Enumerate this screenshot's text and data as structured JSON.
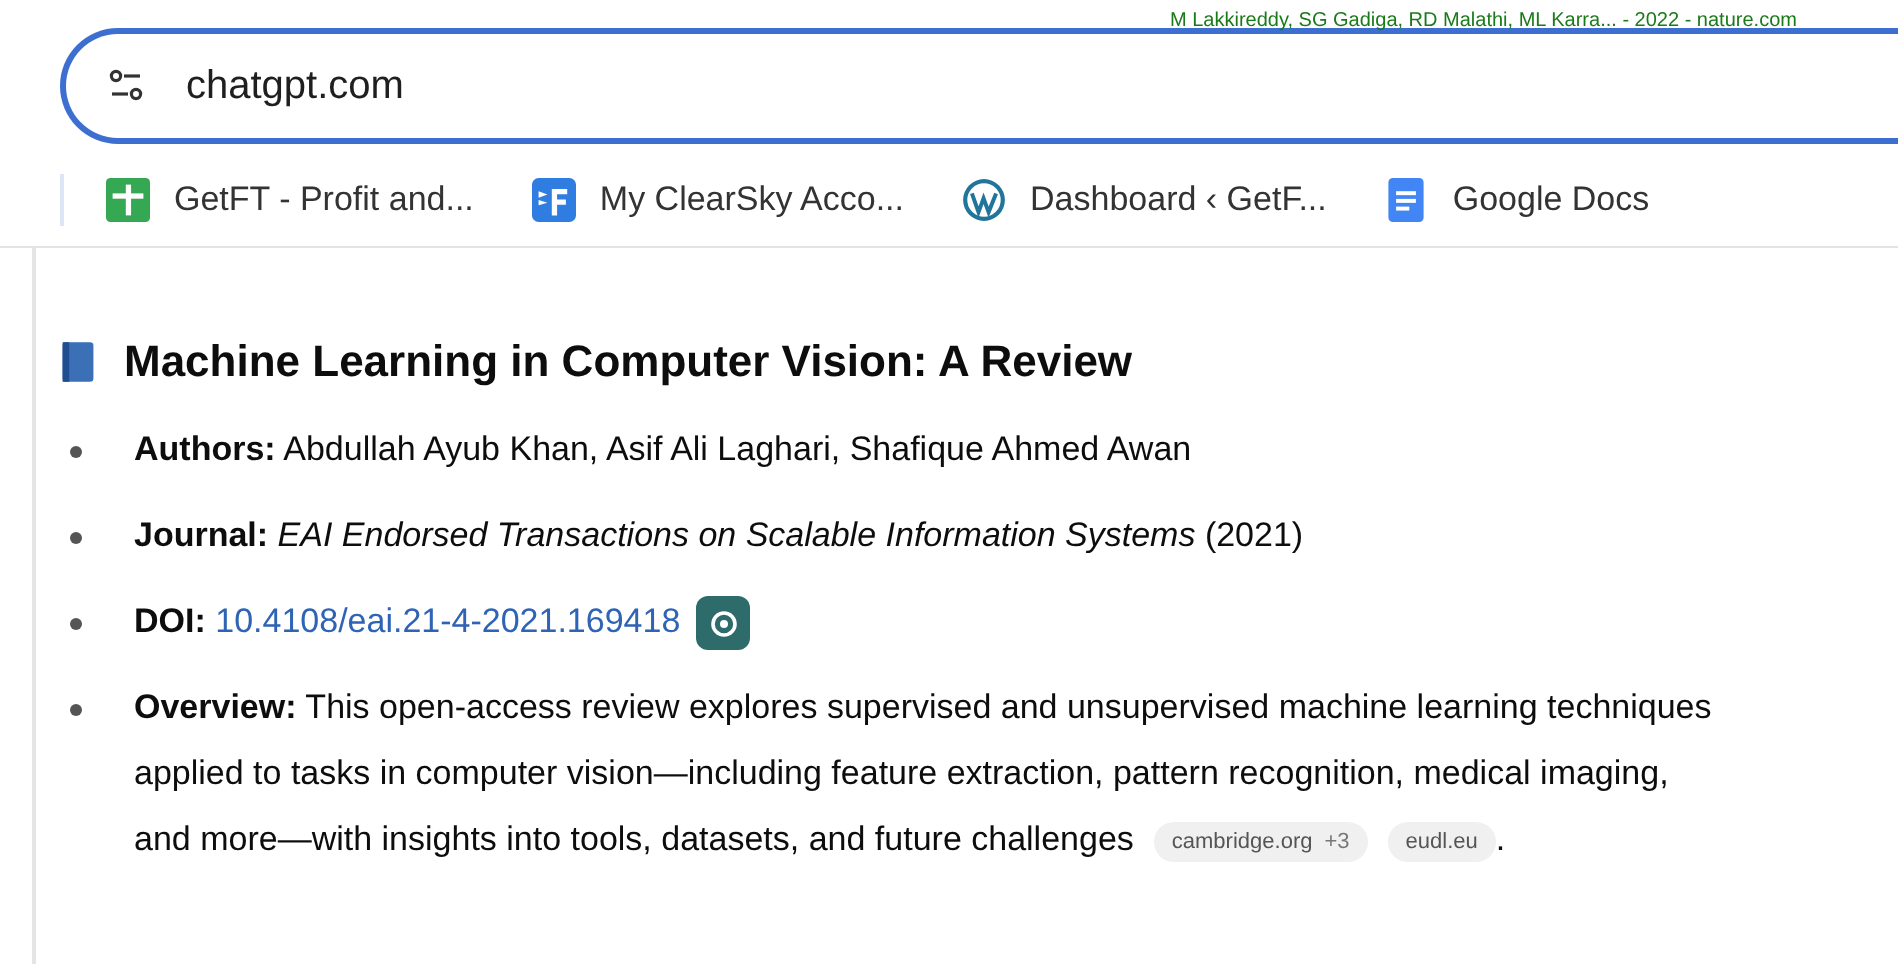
{
  "top_strip": {
    "text": "M Lakkireddy, SG Gadiga, RD Malathi, ML Karra... - 2022 - nature.com"
  },
  "address_bar": {
    "value": "chatgpt.com"
  },
  "bookmarks": [
    {
      "label": "GetFT - Profit and...",
      "kind": "sheet"
    },
    {
      "label": "My ClearSky Acco...",
      "kind": "brand"
    },
    {
      "label": "Dashboard ‹ GetF...",
      "kind": "wordpress"
    },
    {
      "label": "Google Docs",
      "kind": "doc"
    }
  ],
  "article": {
    "title": "Machine Learning in Computer Vision: A Review",
    "items": [
      {
        "text": "**Authors:** Abdullah Ayub Khan, Asif Ali Laghari, Shafique Ahmed Awan"
      },
      {
        "text": "**Journal:** *EAI Endorsed Transactions on Scalable Information Systems* (2021)"
      },
      {
        "text": "**DOI:** ",
        "link": "10.4108/eai.21-4-2021.169418",
        "link_icon": true
      },
      {
        "text": "**Overview:** This open-access review explores supervised and unsupervised machine learning techniques applied to tasks in computer vision—including feature extraction, pattern recognition, medical imaging, and more—with insights into tools, datasets, and future challenges",
        "sources": [
          {
            "name": "cambridge.org",
            "more": "+3"
          },
          {
            "name": "eudl.eu"
          }
        ],
        "trailing": "."
      }
    ]
  }
}
